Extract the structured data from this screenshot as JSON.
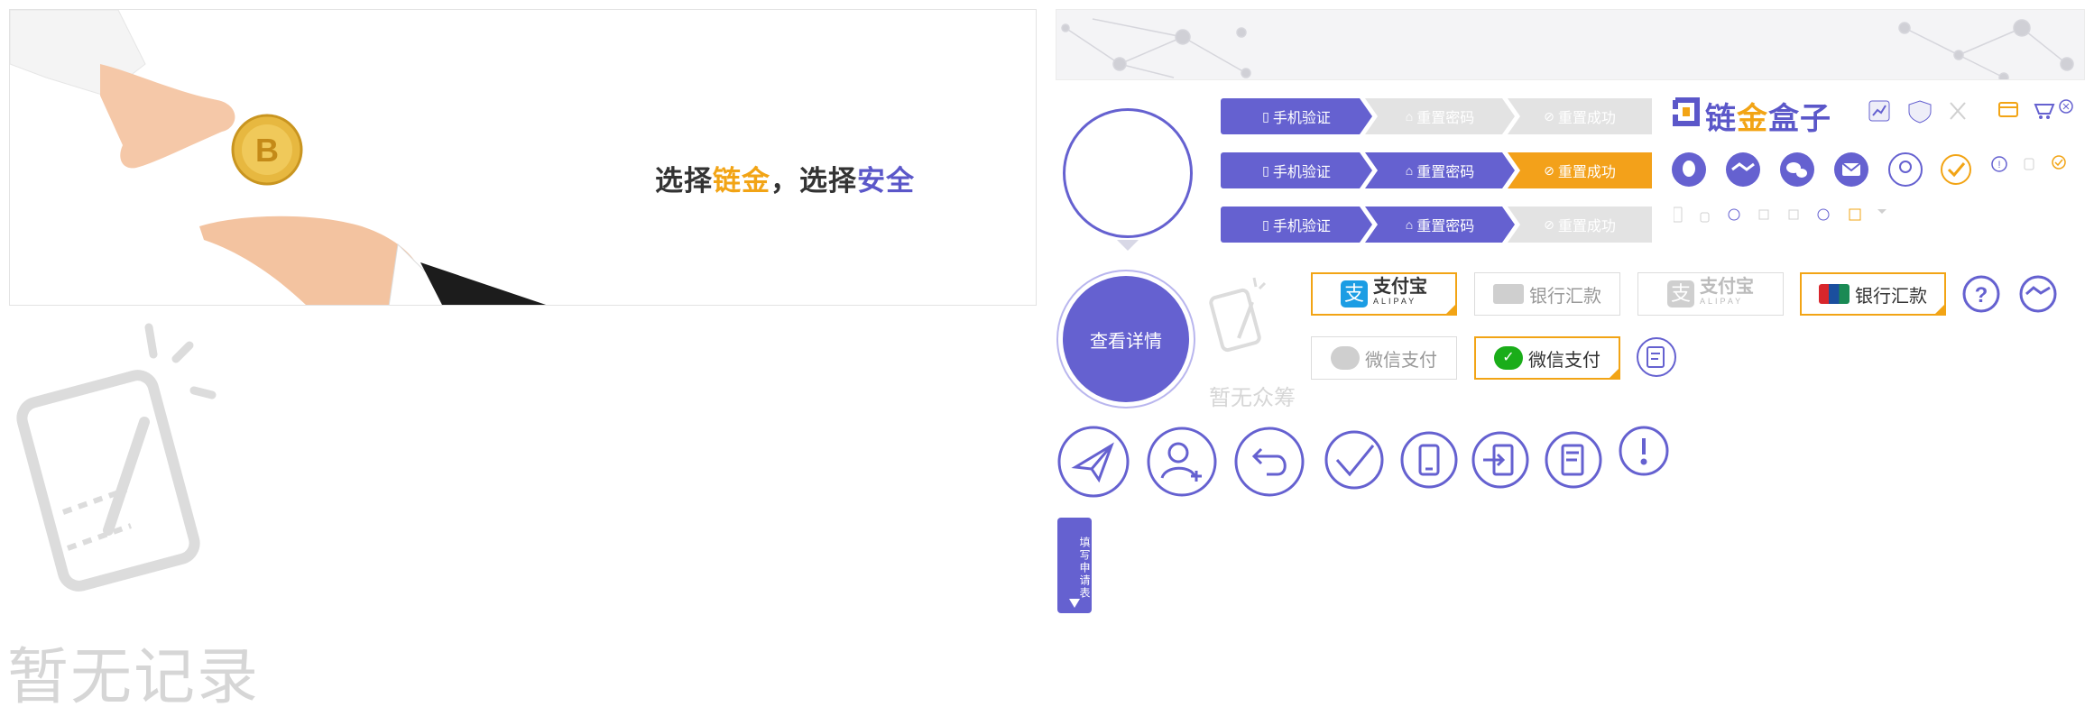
{
  "banner": {
    "slogan_prefix1": "选择",
    "slogan_gold": "链金",
    "slogan_sep": "，",
    "slogan_prefix2": "选择",
    "slogan_purple": "安全"
  },
  "empty_records": {
    "text": "暂无记录"
  },
  "empty_crowdfund": {
    "text": "暂无众筹"
  },
  "steps": {
    "phone_verify": "手机验证",
    "reset_password": "重置密码",
    "reset_success": "重置成功"
  },
  "brand": {
    "prefix": "链",
    "gold": "金",
    "suffix": "盒子"
  },
  "payments": {
    "alipay_cn": "支付宝",
    "alipay_en": "ALIPAY",
    "bank_transfer": "银行汇款",
    "wechat_pay": "微信支付"
  },
  "buttons": {
    "view_details": "查看详情",
    "fill_application": "填写申请表"
  },
  "colors": {
    "primary": "#6561d0",
    "accent": "#f2a415",
    "muted": "#d6d6d6"
  }
}
